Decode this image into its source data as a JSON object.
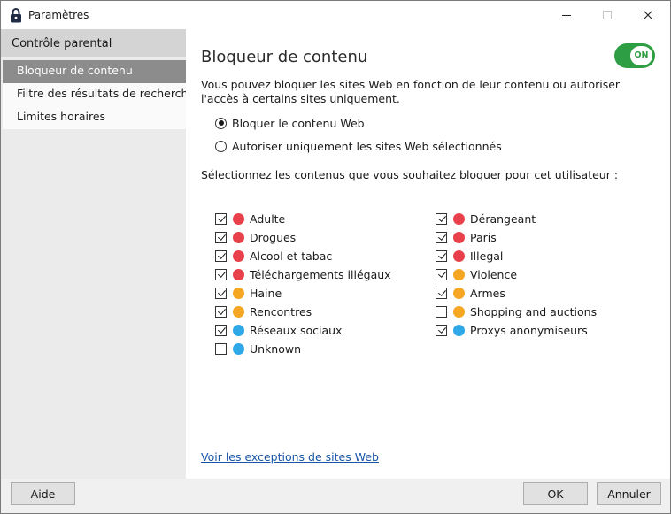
{
  "window": {
    "title": "Paramètres"
  },
  "sidebar": {
    "section_title": "Contrôle parental",
    "items": [
      {
        "label": "Bloqueur de contenu",
        "active": true
      },
      {
        "label": "Filtre des résultats de recherche",
        "active": false
      },
      {
        "label": "Limites horaires",
        "active": false
      }
    ]
  },
  "main": {
    "title": "Bloqueur de contenu",
    "toggle_label": "ON",
    "toggle_on": true,
    "description": "Vous pouvez bloquer les sites Web en fonction de leur contenu ou autoriser l'accès à certains sites uniquement.",
    "radio_options": [
      {
        "label": "Bloquer le contenu Web",
        "checked": true
      },
      {
        "label": "Autoriser uniquement les sites Web sélectionnés",
        "checked": false
      }
    ],
    "select_text": "Sélectionnez les contenus que vous souhaitez bloquer pour cet utilisateur :",
    "categories_left": [
      {
        "label": "Adulte",
        "checked": true,
        "color": "#e8414b",
        "icon": "adult-icon"
      },
      {
        "label": "Drogues",
        "checked": true,
        "color": "#e8414b",
        "icon": "pill-icon"
      },
      {
        "label": "Alcool et tabac",
        "checked": true,
        "color": "#e8414b",
        "icon": "bottle-icon"
      },
      {
        "label": "Téléchargements illégaux",
        "checked": true,
        "color": "#e8414b",
        "icon": "download-icon"
      },
      {
        "label": "Haine",
        "checked": true,
        "color": "#f5a623",
        "icon": "hate-icon"
      },
      {
        "label": "Rencontres",
        "checked": true,
        "color": "#f5a623",
        "icon": "dating-icon"
      },
      {
        "label": "Réseaux sociaux",
        "checked": true,
        "color": "#2fa8e8",
        "icon": "social-icon"
      },
      {
        "label": "Unknown",
        "checked": false,
        "color": "#2fa8e8",
        "icon": "question-icon"
      }
    ],
    "categories_right": [
      {
        "label": "Dérangeant",
        "checked": true,
        "color": "#e8414b",
        "icon": "disturbing-icon"
      },
      {
        "label": "Paris",
        "checked": true,
        "color": "#e8414b",
        "icon": "gambling-icon"
      },
      {
        "label": "Illegal",
        "checked": true,
        "color": "#e8414b",
        "icon": "illegal-icon"
      },
      {
        "label": "Violence",
        "checked": true,
        "color": "#f5a623",
        "icon": "violence-icon"
      },
      {
        "label": "Armes",
        "checked": true,
        "color": "#f5a623",
        "icon": "weapon-icon"
      },
      {
        "label": "Shopping and auctions",
        "checked": false,
        "color": "#f5a623",
        "icon": "shopping-icon"
      },
      {
        "label": "Proxys anonymiseurs",
        "checked": true,
        "color": "#2fa8e8",
        "icon": "proxy-icon"
      }
    ],
    "exceptions_link": "Voir les exceptions de sites Web"
  },
  "footer": {
    "help_label": "Aide",
    "ok_label": "OK",
    "cancel_label": "Annuler"
  }
}
